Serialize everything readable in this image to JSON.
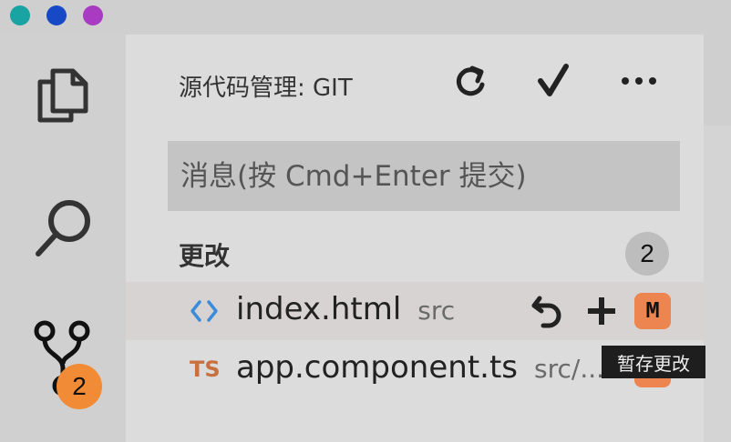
{
  "window": {
    "controls": [
      {
        "name": "close",
        "color": "#1aa3a3"
      },
      {
        "name": "minimize",
        "color": "#1749c7"
      },
      {
        "name": "maximize",
        "color": "#a83bc1"
      }
    ]
  },
  "activity_bar": {
    "items": [
      "explorer-icon",
      "search-icon",
      "source-control-icon"
    ],
    "source_control_badge": "2"
  },
  "scm": {
    "title": "源代码管理: GIT",
    "actions": [
      "refresh-icon",
      "commit-checkmark-icon",
      "more-icon"
    ],
    "message_placeholder": "消息(按 Cmd+Enter 提交)",
    "changes_label": "更改",
    "changes_count": "2",
    "files": [
      {
        "name": "index.html",
        "path": "src",
        "icon": "html-icon",
        "status": "M"
      },
      {
        "name": "app.component.ts",
        "path": "src/...",
        "icon": "TS",
        "status": "M"
      }
    ],
    "tooltip": "暂存更改"
  },
  "colors": {
    "accent": "#f28b35",
    "modified": "#ec8550",
    "html_icon": "#3b8cd8",
    "ts_icon": "#c8703f"
  }
}
